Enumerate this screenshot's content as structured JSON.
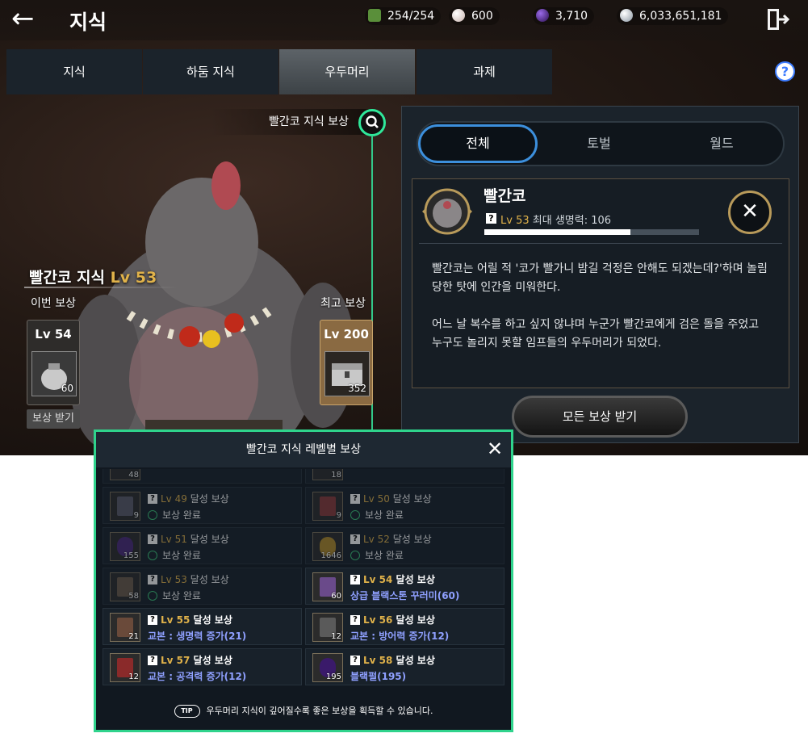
{
  "header": {
    "title": "지식",
    "currencies": [
      {
        "icon": "green-gem-icon",
        "value": "254/254",
        "color": "#4caf50"
      },
      {
        "icon": "pearl-icon",
        "value": "600",
        "color": "#e9d6d0"
      },
      {
        "icon": "purple-orb-icon",
        "value": "3,710",
        "color": "#5a2ca8"
      },
      {
        "icon": "silver-coin-icon",
        "value": "6,033,651,181",
        "color": "#c9d2da"
      }
    ]
  },
  "tabs": [
    "지식",
    "하둠 지식",
    "우두머리",
    "과제"
  ],
  "active_tab": "우두머리",
  "showcase": {
    "reward_banner": "빨간코 지식 보상",
    "knowledge_name": "빨간코 지식",
    "knowledge_level": "Lv 53",
    "current_label": "이번 보상",
    "best_label": "최고 보상",
    "current_reward": {
      "level": "Lv 54",
      "count": "60"
    },
    "best_reward": {
      "level": "Lv 200",
      "count": "352"
    },
    "claim_label": "보상 받기"
  },
  "filter": [
    "전체",
    "토벌",
    "월드"
  ],
  "monster": {
    "name": "빨간코",
    "level": "Lv 53",
    "hp_label": "최대 생명력: 106",
    "hp_fraction": 0.68,
    "description": "빨간코는 어릴 적 '코가 빨가니 밤길 걱정은 안해도 되겠는데?'하며 놀림 당한 탓에 인간을 미워한다.\n\n어느 날 복수를 하고 싶지 않냐며 누군가 빨간코에게 검은 돌을 주었고 누구도 놀리지 못할 임프들의 우두머리가 되었다."
  },
  "claim_all_label": "모든 보상 받기",
  "modal": {
    "title": "빨간코 지식 레벨별 보상",
    "partial_top": [
      {
        "count": "48"
      },
      {
        "count": "18"
      }
    ],
    "items": [
      {
        "level": "Lv 49",
        "suffix": "달성 보상",
        "status": "보상 완료",
        "done": true,
        "count": "9",
        "icon": "book-icon",
        "color": "#5a5a6a"
      },
      {
        "level": "Lv 50",
        "suffix": "달성 보상",
        "status": "보상 완료",
        "done": true,
        "count": "9",
        "icon": "book-icon",
        "color": "#8a3a3a"
      },
      {
        "level": "Lv 51",
        "suffix": "달성 보상",
        "status": "보상 완료",
        "done": true,
        "count": "155",
        "icon": "black-pearl-icon",
        "color": "#4b2a7a"
      },
      {
        "level": "Lv 52",
        "suffix": "달성 보상",
        "status": "보상 완료",
        "done": true,
        "count": "1646",
        "icon": "coin-icon",
        "color": "#b08a2a"
      },
      {
        "level": "Lv 53",
        "suffix": "달성 보상",
        "status": "보상 완료",
        "done": true,
        "count": "58",
        "icon": "chest-icon",
        "color": "#6a5a4a"
      },
      {
        "level": "Lv 54",
        "suffix": "달성 보상",
        "status": "상급 블랙스톤 꾸러미(60)",
        "done": false,
        "count": "60",
        "icon": "pouch-icon",
        "color": "#6a4a8a"
      },
      {
        "level": "Lv 55",
        "suffix": "달성 보상",
        "status": "교본 : 생명력 증가(21)",
        "done": false,
        "count": "21",
        "icon": "book-icon",
        "color": "#6a4a3a"
      },
      {
        "level": "Lv 56",
        "suffix": "달성 보상",
        "status": "교본 : 방어력 증가(12)",
        "done": false,
        "count": "12",
        "icon": "book-icon",
        "color": "#5a5a5a"
      },
      {
        "level": "Lv 57",
        "suffix": "달성 보상",
        "status": "교본 : 공격력 증가(12)",
        "done": false,
        "count": "12",
        "icon": "book-icon",
        "color": "#8a2a2a"
      },
      {
        "level": "Lv 58",
        "suffix": "달성 보상",
        "status": "블랙펄(195)",
        "done": false,
        "count": "195",
        "icon": "black-pearl-icon",
        "color": "#3a1a6a"
      }
    ],
    "tip_badge": "TIP",
    "tip": "우두머리 지식이 깊어질수록 좋은 보상을 획득할 수 있습니다."
  }
}
